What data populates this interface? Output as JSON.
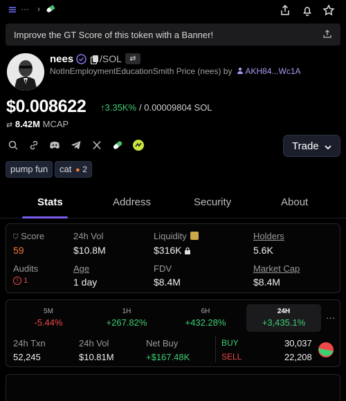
{
  "topbar": {
    "icons": [
      "menu-icon",
      "more-dots-icon",
      "chevron-right-icon",
      "pill-icon",
      "share-icon",
      "bell-icon",
      "star-icon"
    ]
  },
  "banner": {
    "text": "Improve the GT Score of this token with a Banner!"
  },
  "token": {
    "name": "nees",
    "pair": "/SOL",
    "swap_glyph": "⇄",
    "sub_text": "NotInEmploymentEducationSmith Price (nees) by",
    "creator": "AKH84...Wc1A",
    "price": "$0.008622",
    "change": "↑3.35K%",
    "price_sol": "/ 0.00009804 SOL",
    "mcap_value": "8.42M",
    "mcap_label": "MCAP"
  },
  "trade": {
    "label": "Trade"
  },
  "tags": [
    {
      "label": "pump fun"
    },
    {
      "label": "cat",
      "count": "2"
    }
  ],
  "tabs": [
    {
      "label": "Stats",
      "active": true
    },
    {
      "label": "Address"
    },
    {
      "label": "Security"
    },
    {
      "label": "About"
    }
  ],
  "stats": {
    "score_label": "Score",
    "score_value": "59",
    "vol_label": "24h Vol",
    "vol_value": "$10.8M",
    "liq_label": "Liquidity",
    "liq_value": "$316K",
    "holders_label": "Holders",
    "holders_value": "5.6K",
    "audits_label": "Audits",
    "audits_value": "1",
    "age_label": "Age",
    "age_value": "1 day",
    "fdv_label": "FDV",
    "fdv_value": "$8.4M",
    "mcap_label": "Market Cap",
    "mcap_value": "$8.4M"
  },
  "periods": [
    {
      "label": "5M",
      "value": "-5.44%",
      "dir": "down"
    },
    {
      "label": "1H",
      "value": "+267.82%",
      "dir": "up"
    },
    {
      "label": "6H",
      "value": "+432.28%",
      "dir": "up"
    },
    {
      "label": "24H",
      "value": "+3,435.1%",
      "dir": "up",
      "selected": true
    }
  ],
  "trades": {
    "txn_label": "24h Txn",
    "txn_value": "52,245",
    "vol_label": "24h Vol",
    "vol_value": "$10.81M",
    "netbuy_label": "Net Buy",
    "netbuy_value": "+$167.48K",
    "buy_label": "BUY",
    "buy_value": "30,037",
    "sell_label": "SELL",
    "sell_value": "22,208"
  },
  "colors": {
    "accent": "#7b5cf0",
    "up": "#3ecf73",
    "down": "#f04848",
    "score": "#f5793b",
    "creator": "#a99bf5"
  }
}
